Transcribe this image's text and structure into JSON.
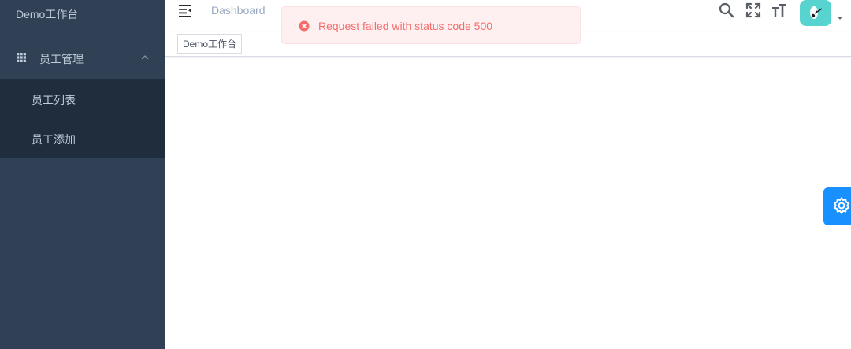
{
  "sidebar": {
    "title": "Demo工作台",
    "menu": {
      "label": "员工管理",
      "icon": "grid-icon",
      "expanded": true,
      "items": [
        {
          "label": "员工列表"
        },
        {
          "label": "员工添加"
        }
      ]
    }
  },
  "navbar": {
    "breadcrumb": "Dashboard",
    "icons": [
      "hamburger-icon",
      "search-icon",
      "fullscreen-icon",
      "font-size-icon",
      "avatar",
      "caret-down-icon"
    ]
  },
  "tags": [
    {
      "label": "Demo工作台"
    }
  ],
  "toast": {
    "type": "error",
    "message": "Request failed with status code 500"
  },
  "settings": {
    "icon": "gear-icon"
  },
  "colors": {
    "sidebar_bg": "#304156",
    "submenu_bg": "#1f2d3d",
    "sidebar_text": "#bfcbd9",
    "toast_bg": "#fef0f0",
    "toast_text": "#f56c6c",
    "accent": "#1890ff",
    "avatar_bg": "#57d3d0"
  }
}
